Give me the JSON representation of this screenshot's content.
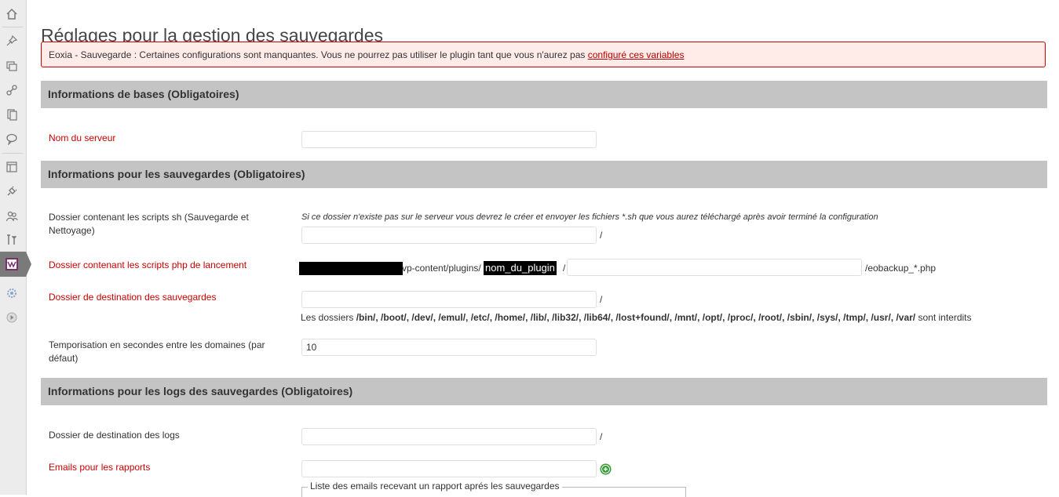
{
  "sidebar": {
    "icons": [
      "home-icon",
      "pin-icon",
      "media-icon",
      "link-icon",
      "pages-icon",
      "comments-icon",
      "appearance-icon",
      "plugins-icon",
      "users-icon",
      "tools-icon",
      "plugin-active-icon",
      "settings-icon",
      "collapse-icon"
    ]
  },
  "page": {
    "title": "Réglages pour la gestion des sauvegardes"
  },
  "notice": {
    "text": "Eoxia - Sauvegarde : Certaines configurations sont manquantes. Vous ne pourrez pas utiliser le plugin tant que vous n'aurez pas ",
    "link": "configuré ces variables"
  },
  "sections": {
    "base": "Informations de bases (Obligatoires)",
    "backups": "Informations pour les sauvegardes (Obligatoires)",
    "logs": "Informations pour les logs des sauvegardes (Obligatoires)"
  },
  "fields": {
    "server_name": {
      "label": "Nom du serveur",
      "value": ""
    },
    "sh_folder": {
      "label": "Dossier contenant les scripts sh (Sauvegarde et Nettoyage)",
      "description": "Si ce dossier n'existe pas sur le serveur vous devrez le créer et envoyer les fichiers *.sh que vous aurez téléchargé après avoir terminé la configuration",
      "value": "",
      "suffix": "/"
    },
    "php_folder": {
      "label": "Dossier contenant les scripts php de lancement",
      "path_prefix": "vp-content/plugins/",
      "plugin_name": "nom_du_plugin",
      "path_sep": "/",
      "value": "",
      "suffix": "/eobackup_*.php"
    },
    "dest_folder": {
      "label": "Dossier de destination des sauvegardes",
      "value": "",
      "suffix": "/",
      "forbidden_prefix": "Les dossiers ",
      "forbidden_dirs": "/bin/, /boot/, /dev/, /emul/, /etc/, /home/, /lib/, /lib32/, /lib64/, /lost+found/, /mnt/, /opt/, /proc/, /root/, /sbin/, /sys/, /tmp/, /usr/, /var/",
      "forbidden_suffix": " sont interdits"
    },
    "delay": {
      "label": "Temporisation en secondes entre les domaines (par défaut)",
      "value": "10"
    },
    "logs_folder": {
      "label": "Dossier de destination des logs",
      "value": "",
      "suffix": "/"
    },
    "emails": {
      "label": "Emails pour les rapports",
      "value": "",
      "list_legend": "Liste des emails recevant un rapport aprés les sauvegardes"
    }
  },
  "colors": {
    "required": "#cc0000",
    "section_bg": "#c4c4c4",
    "notice_bg": "#ffebe8",
    "add_icon": "#2e9e2e"
  }
}
